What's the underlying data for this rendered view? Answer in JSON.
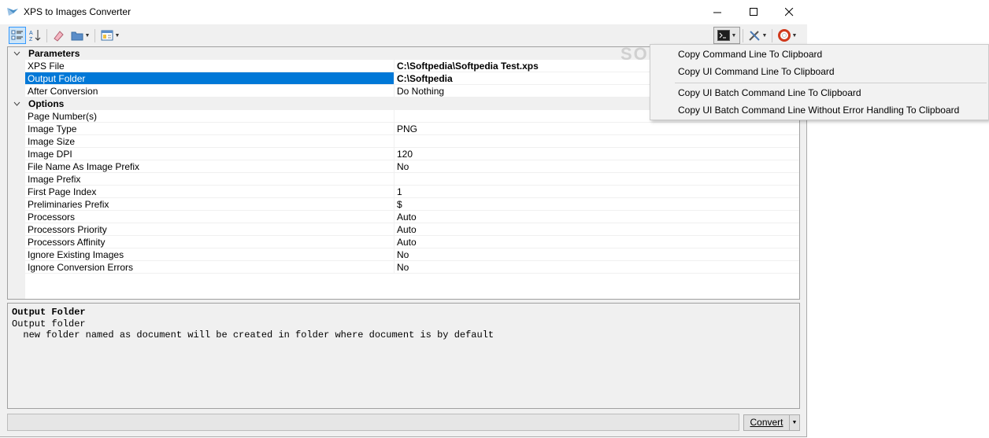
{
  "window": {
    "title": "XPS to Images Converter",
    "minimize_glyph": "—",
    "maximize_glyph": "☐",
    "close_glyph": "✕"
  },
  "toolbar": {
    "icons": [
      "categorized-icon",
      "sort-az-icon",
      "eraser-icon",
      "folder-icon",
      "layout-icon",
      "console-icon",
      "tools-icon",
      "help-icon"
    ]
  },
  "grid": {
    "parameters_label": "Parameters",
    "options_label": "Options",
    "parameters": [
      {
        "name": "XPS File",
        "value": "C:\\Softpedia\\Softpedia Test.xps",
        "bold": true
      },
      {
        "name": "Output Folder",
        "value": "C:\\Softpedia",
        "bold": true,
        "selected": true
      },
      {
        "name": "After Conversion",
        "value": "Do Nothing"
      }
    ],
    "options": [
      {
        "name": "Page Number(s)",
        "value": ""
      },
      {
        "name": "Image Type",
        "value": "PNG"
      },
      {
        "name": "Image Size",
        "value": ""
      },
      {
        "name": "Image DPI",
        "value": "120"
      },
      {
        "name": "File Name As Image Prefix",
        "value": "No"
      },
      {
        "name": "Image Prefix",
        "value": ""
      },
      {
        "name": "First Page Index",
        "value": "1"
      },
      {
        "name": "Preliminaries Prefix",
        "value": "$"
      },
      {
        "name": "Processors",
        "value": "Auto"
      },
      {
        "name": "Processors Priority",
        "value": "Auto"
      },
      {
        "name": "Processors Affinity",
        "value": "Auto"
      },
      {
        "name": "Ignore Existing Images",
        "value": "No"
      },
      {
        "name": "Ignore Conversion Errors",
        "value": "No"
      }
    ]
  },
  "description": {
    "title": "Output Folder",
    "line1": "Output folder",
    "line2": "  new folder named as document will be created in folder where document is by default"
  },
  "convert_button": {
    "label": "Convert"
  },
  "context_menu": {
    "items": [
      "Copy Command Line To Clipboard",
      "Copy UI Command Line To Clipboard",
      "Copy UI Batch Command Line To Clipboard",
      "Copy UI Batch Command Line Without Error Handling To Clipboard"
    ]
  },
  "watermark": "SOFTPEDIA",
  "colors": {
    "selection": "#0078d7",
    "accent": "#3399ff"
  }
}
